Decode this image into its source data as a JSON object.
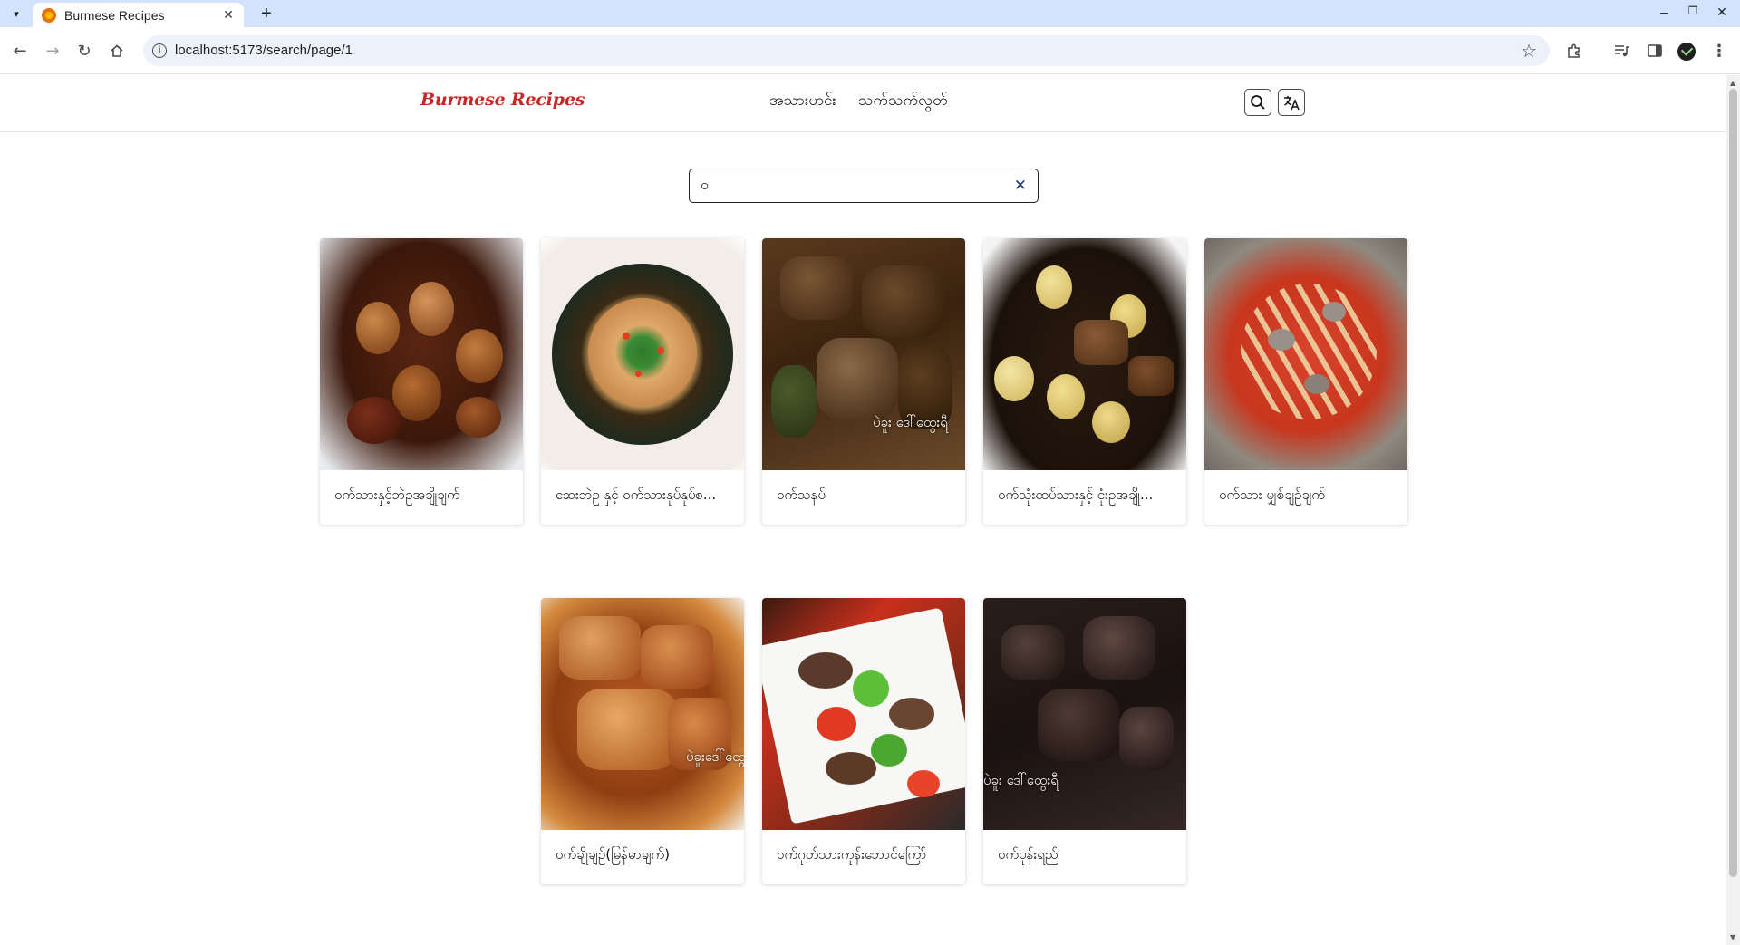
{
  "browser": {
    "tab_title": "Burmese Recipes",
    "url": "localhost:5173/search/page/1"
  },
  "site": {
    "logo": "Burmese Recipes",
    "nav": [
      "အသားဟင်း",
      "သက်သက်လွတ်"
    ]
  },
  "search": {
    "value": "ဝ",
    "clear_symbol": "✕"
  },
  "recipes": [
    {
      "title": "ဝက်သားနှင့်ဘဲဥအချိုချက်",
      "watermark": ""
    },
    {
      "title": "ဆေးဘဲဥ နှင့် ဝက်သားနုပ်နုပ်စ...",
      "watermark": ""
    },
    {
      "title": "ဝက်သနပ်",
      "watermark": "ပဲခူး ဒေါ်ထွေးရီ"
    },
    {
      "title": "ဝက်သုံးထပ်သားနှင့် ငုံးဥအချို...",
      "watermark": ""
    },
    {
      "title": "ဝက်သား မျှစ်ချဉ်ချက်",
      "watermark": ""
    },
    {
      "title": "ဝက်ချိုချဉ်(မြန်မာချက်)",
      "watermark": "ပဲခူးဒေါ်ထွေ"
    },
    {
      "title": "ဝက်ဂုတ်သားကုန်းဘောင်ကြော်",
      "watermark": ""
    },
    {
      "title": "ဝက်ပုန်းရည်",
      "watermark": "ပဲခူး ဒေါ်ထွေးရီ"
    }
  ]
}
